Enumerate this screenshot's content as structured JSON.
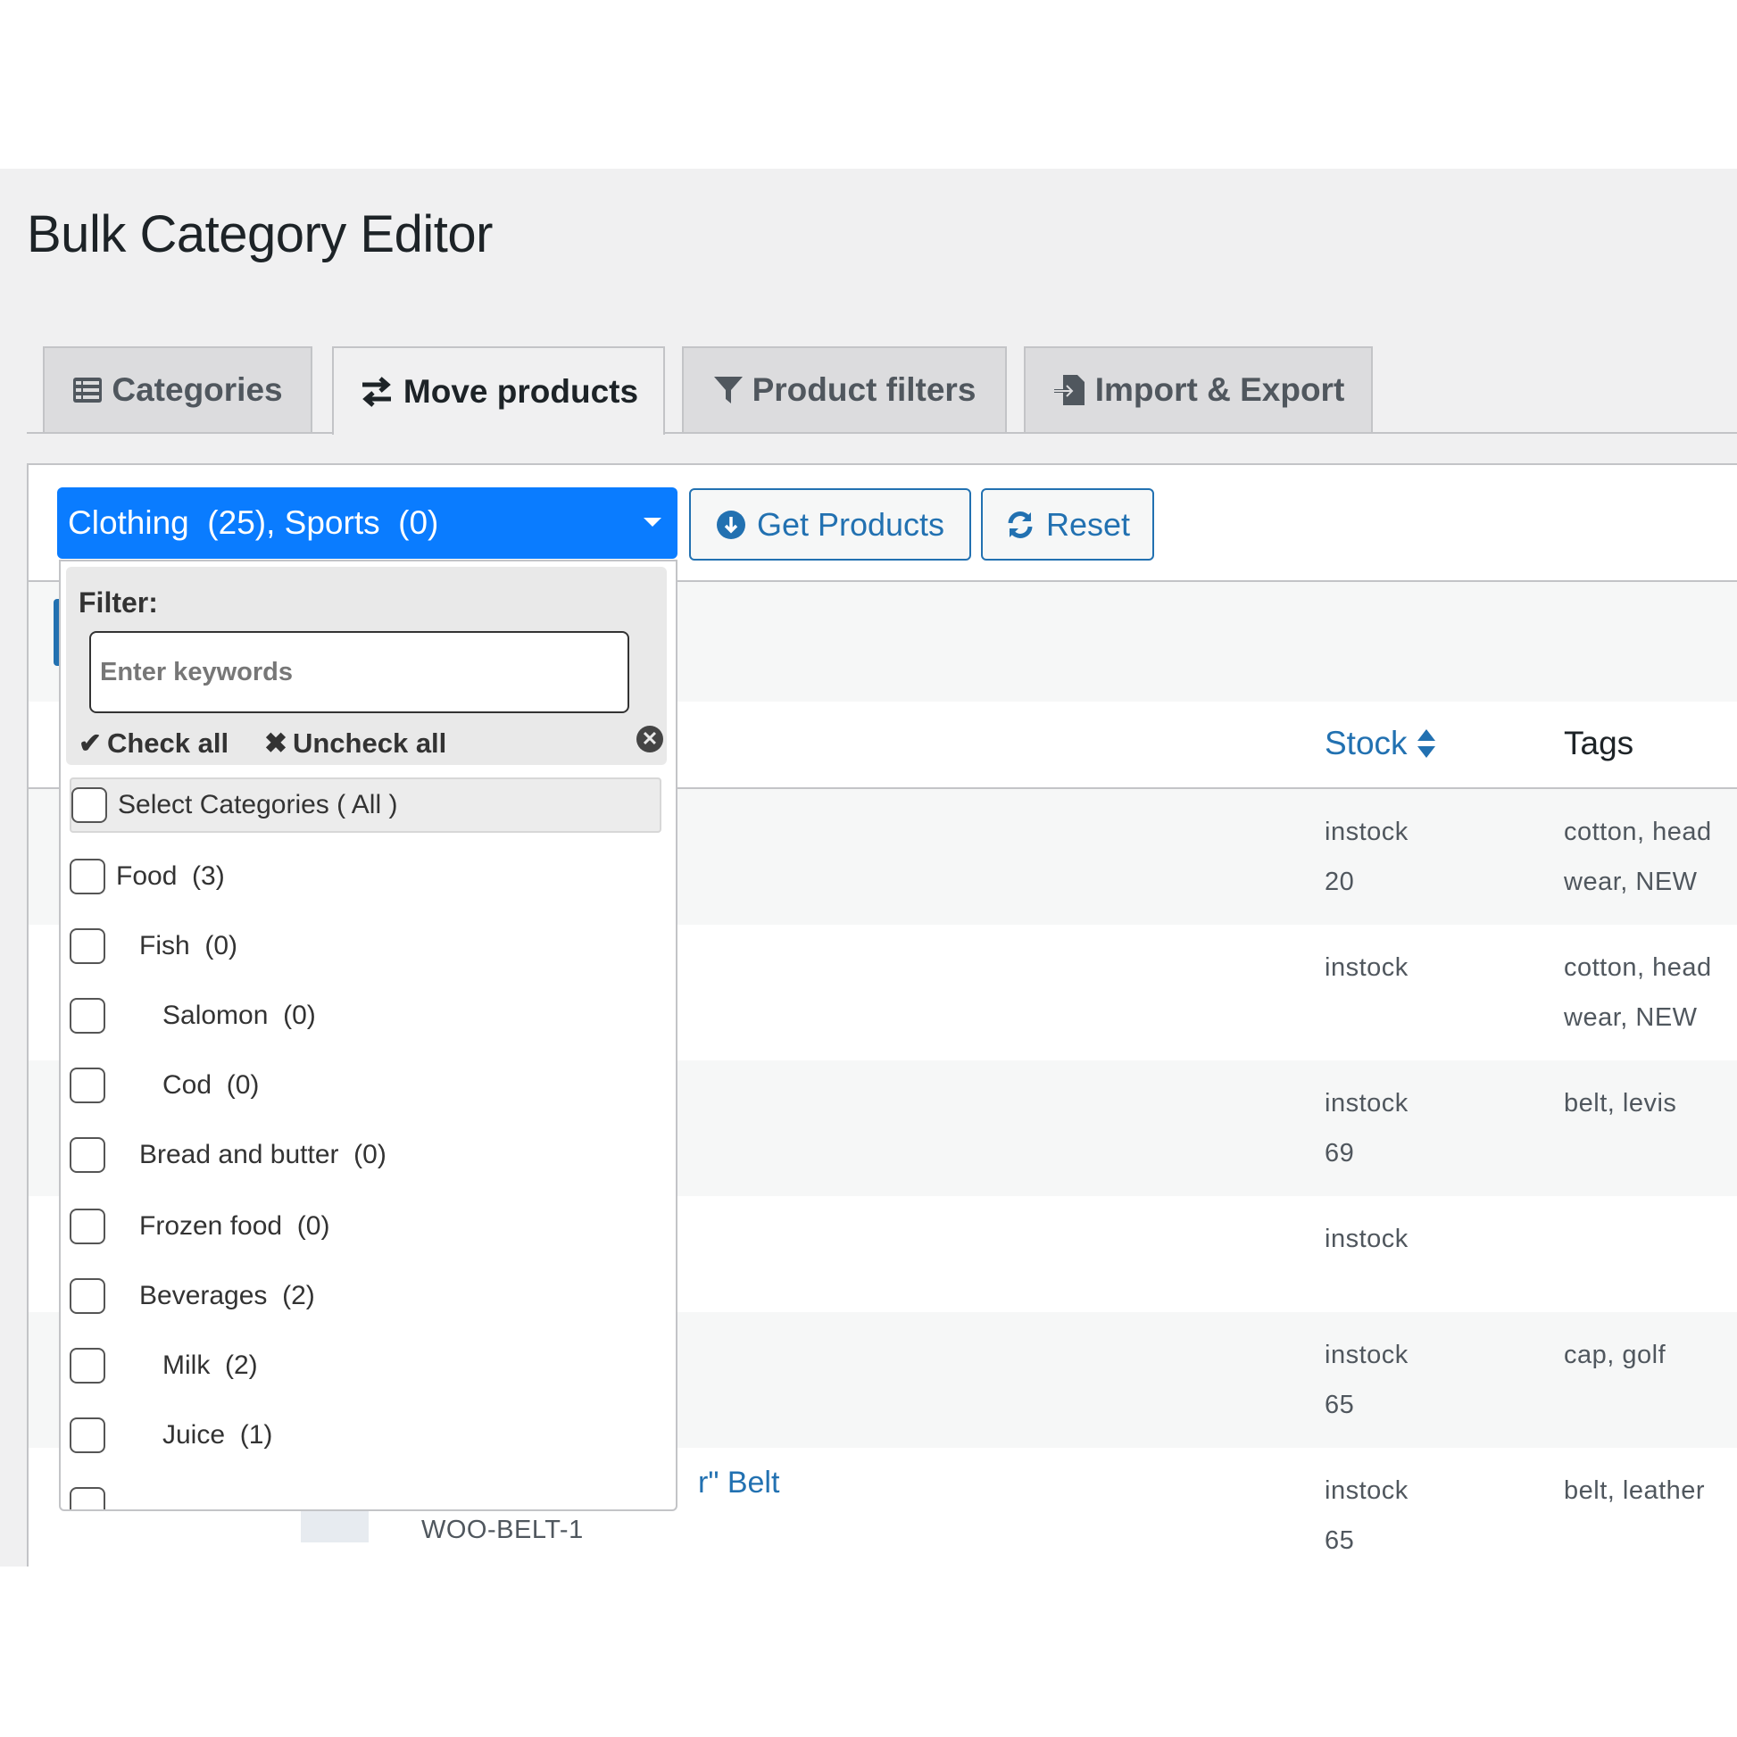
{
  "page": {
    "title": "Bulk Category Editor"
  },
  "tabs": [
    {
      "label": "Categories",
      "icon": "table-list-icon",
      "active": false
    },
    {
      "label": "Move products",
      "icon": "exchange-arrows-icon",
      "active": true
    },
    {
      "label": "Product filters",
      "icon": "funnel-icon",
      "active": false
    },
    {
      "label": "Import & Export",
      "icon": "file-import-icon",
      "active": false
    }
  ],
  "toolbar": {
    "category_select_value": "Clothing  (25), Sports  (0)",
    "get_products_label": "Get Products",
    "reset_label": "Reset"
  },
  "dropdown": {
    "filter_label": "Filter:",
    "filter_placeholder": "Enter keywords",
    "filter_value": "",
    "check_all_label": "Check all",
    "uncheck_all_label": "Uncheck all",
    "options": [
      {
        "label": "Select Categories ( All )",
        "level": 0,
        "checked": false
      },
      {
        "label": "Food  (3)",
        "level": 0,
        "checked": false
      },
      {
        "label": "Fish  (0)",
        "level": 1,
        "checked": false
      },
      {
        "label": "Salomon  (0)",
        "level": 2,
        "checked": false
      },
      {
        "label": "Cod  (0)",
        "level": 2,
        "checked": false
      },
      {
        "label": "Bread and butter  (0)",
        "level": 1,
        "checked": false
      },
      {
        "label": "Frozen food  (0)",
        "level": 1,
        "checked": false
      },
      {
        "label": "Beverages  (2)",
        "level": 1,
        "checked": false
      },
      {
        "label": "Milk  (2)",
        "level": 2,
        "checked": false
      },
      {
        "label": "Juice  (1)",
        "level": 2,
        "checked": false
      }
    ]
  },
  "table": {
    "columns": {
      "stock": "Stock",
      "tags": "Tags"
    },
    "rows": [
      {
        "stock_status": "instock",
        "stock_qty": "20",
        "tags": "cotton, head wear, NEW"
      },
      {
        "stock_status": "instock",
        "stock_qty": "",
        "tags": "cotton, head wear, NEW"
      },
      {
        "stock_status": "instock",
        "stock_qty": "69",
        "tags": "belt, levis"
      },
      {
        "stock_status": "instock",
        "stock_qty": "",
        "tags": ""
      },
      {
        "stock_status": "instock",
        "stock_qty": "65",
        "tags": "cap, golf"
      },
      {
        "name_partial": "r\" Belt",
        "sku": "WOO-BELT-1",
        "stock_status": "instock",
        "stock_qty": "65",
        "tags": "belt, leather"
      }
    ]
  },
  "colors": {
    "primary_blue": "#0a7cff",
    "link_blue": "#2271b1"
  }
}
